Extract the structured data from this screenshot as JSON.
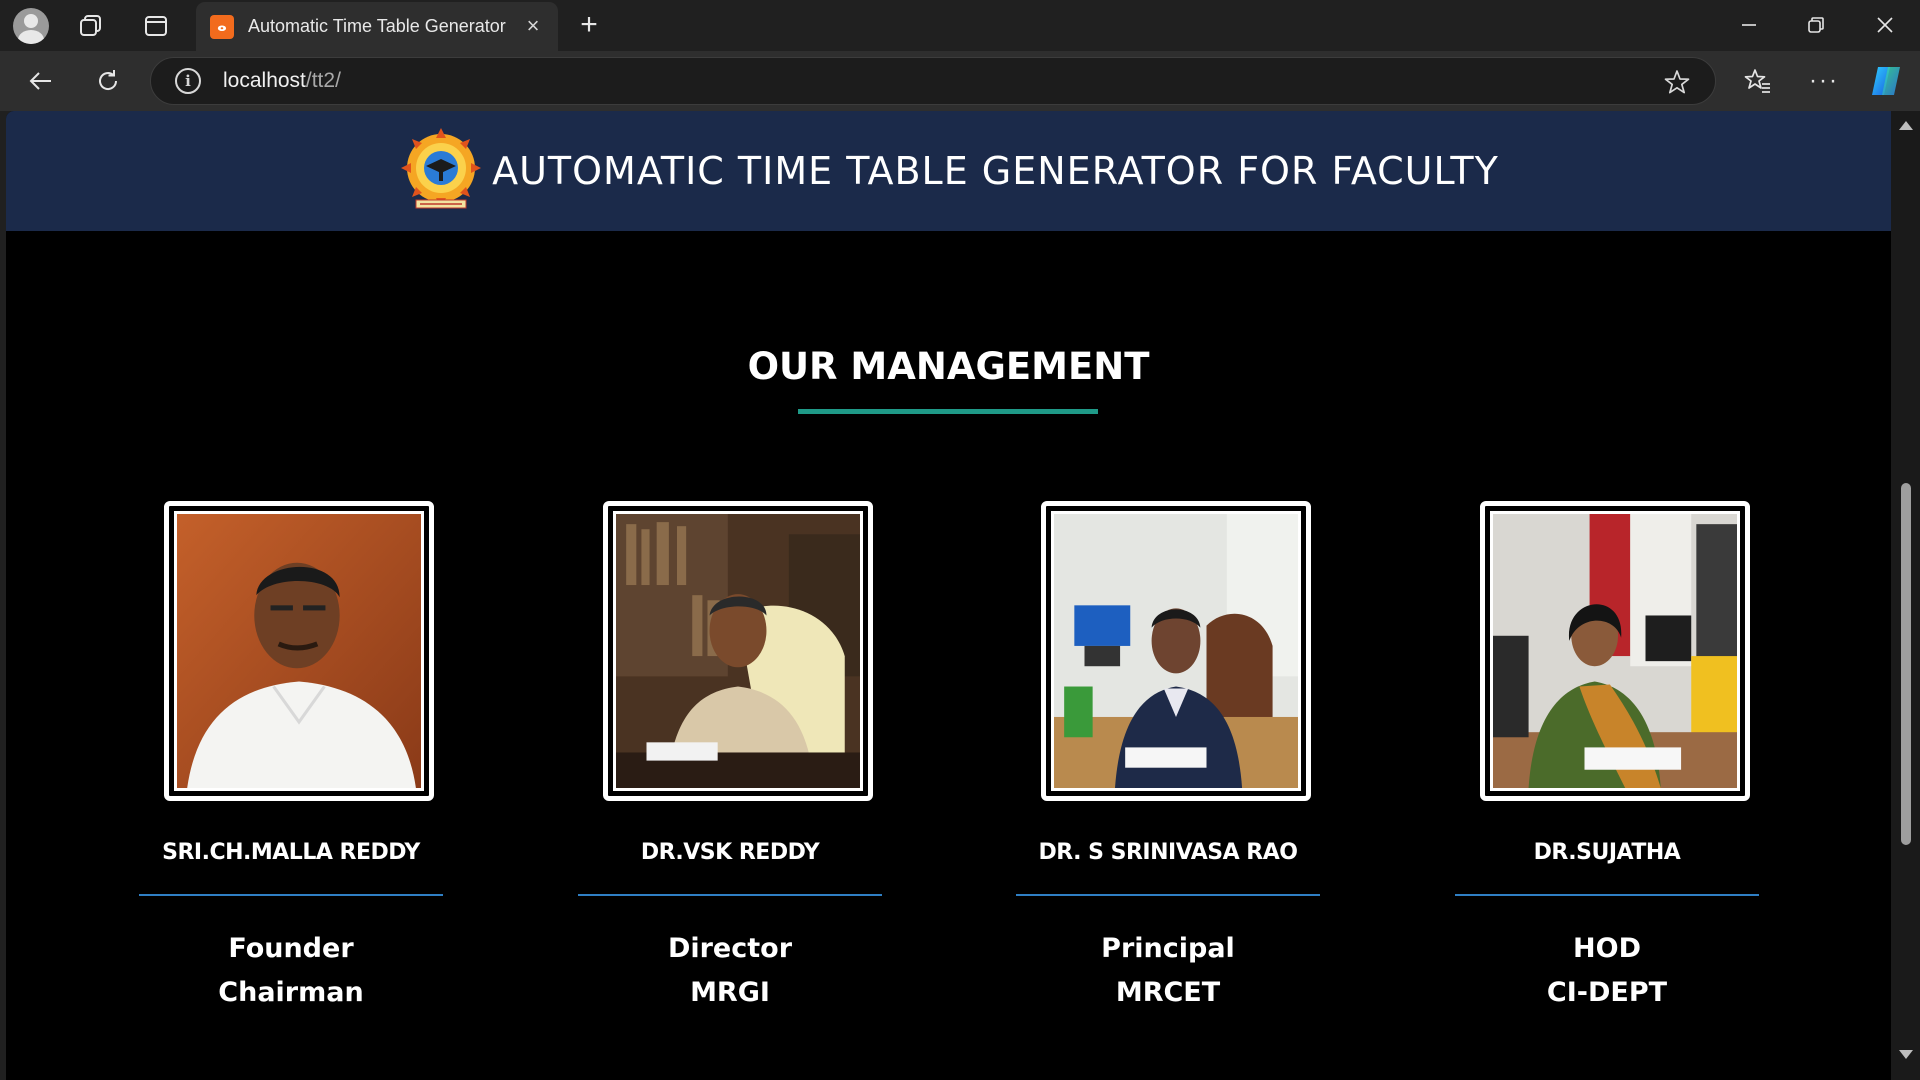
{
  "browser": {
    "tab_title": "Automatic Time Table Generator",
    "tab_favicon_text": "ⴰ",
    "url_host": "localhost",
    "url_path": "/tt2/"
  },
  "site": {
    "title": "AUTOMATIC TIME TABLE GENERATOR FOR FACULTY",
    "header_color": "#1b2a4a"
  },
  "management": {
    "heading": "OUR MANAGEMENT",
    "accent_color": "#1f9a88",
    "members": [
      {
        "name": "SRI.CH.MALLA REDDY",
        "role_line1": "Founder",
        "role_line2": "Chairman"
      },
      {
        "name": "DR.VSK REDDY",
        "role_line1": "Director",
        "role_line2": "MRGI"
      },
      {
        "name": "DR. S SRINIVASA RAO",
        "role_line1": "Principal",
        "role_line2": "MRCET"
      },
      {
        "name": "DR.SUJATHA",
        "role_line1": "HOD",
        "role_line2": "CI-DEPT"
      }
    ]
  }
}
